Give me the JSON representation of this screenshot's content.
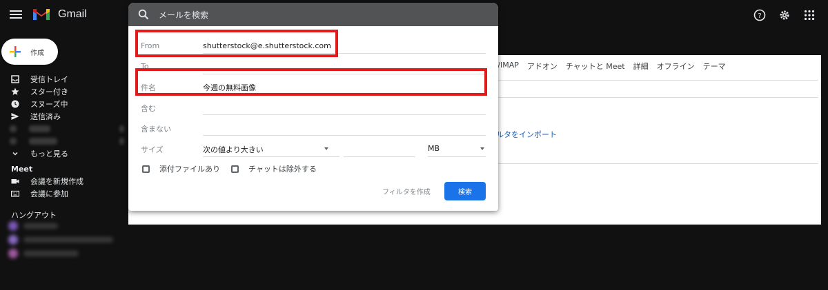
{
  "app": {
    "brand": "Gmail"
  },
  "sidebar": {
    "compose_label": "作成",
    "items": [
      {
        "label": "受信トレイ",
        "icon": "inbox-icon"
      },
      {
        "label": "スター付き",
        "icon": "star-icon"
      },
      {
        "label": "スヌーズ中",
        "icon": "clock-icon"
      },
      {
        "label": "送信済み",
        "icon": "send-icon"
      }
    ],
    "more_label": "もっと見る",
    "meet": {
      "title": "Meet",
      "new_meeting": "会議を新規作成",
      "join_meeting": "会議に参加"
    },
    "hangouts_title": "ハングアウト"
  },
  "search": {
    "placeholder": "メールを検索",
    "from_label": "From",
    "from_value": "shutterstock@e.shutterstock.com",
    "to_label": "To",
    "subject_label": "件名",
    "subject_value": "今週の無料画像",
    "has_words_label": "含む",
    "not_has_label": "含まない",
    "size_label": "サイズ",
    "size_option": "次の値より大きい",
    "size_unit": "MB",
    "has_attachment_label": "添付ファイルあり",
    "exclude_chats_label": "チャットは除外する",
    "create_filter_label": "フィルタを作成",
    "search_button_label": "検索"
  },
  "settings_panel": {
    "tabs": [
      "OP/IMAP",
      "アドオン",
      "チャットと Meet",
      "詳細",
      "オフライン",
      "テーマ"
    ],
    "import_link": "ルタをインポート"
  },
  "colors": {
    "accent": "#1a73e8",
    "highlight": "#e11b1b",
    "background": "#111111"
  }
}
